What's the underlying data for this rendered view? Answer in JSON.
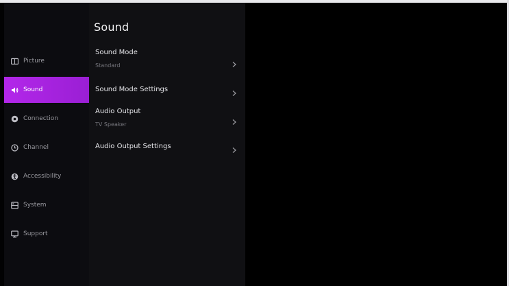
{
  "sidebar": {
    "items": [
      {
        "label": "Picture",
        "icon": "picture-icon",
        "active": false
      },
      {
        "label": "Sound",
        "icon": "sound-icon",
        "active": true
      },
      {
        "label": "Connection",
        "icon": "connection-icon",
        "active": false
      },
      {
        "label": "Channel",
        "icon": "channel-icon",
        "active": false
      },
      {
        "label": "Accessibility",
        "icon": "accessibility-icon",
        "active": false
      },
      {
        "label": "System",
        "icon": "system-icon",
        "active": false
      },
      {
        "label": "Support",
        "icon": "support-icon",
        "active": false
      }
    ]
  },
  "panel": {
    "title": "Sound",
    "items": [
      {
        "label": "Sound Mode",
        "value": "Standard"
      },
      {
        "label": "Sound Mode Settings",
        "value": ""
      },
      {
        "label": "Audio Output",
        "value": "TV Speaker"
      },
      {
        "label": "Audio Output Settings",
        "value": ""
      }
    ]
  },
  "colors": {
    "accent": "#b327ea",
    "background": "#020203",
    "sidebar_bg": "#0c0c10",
    "panel_bg": "#101013"
  }
}
